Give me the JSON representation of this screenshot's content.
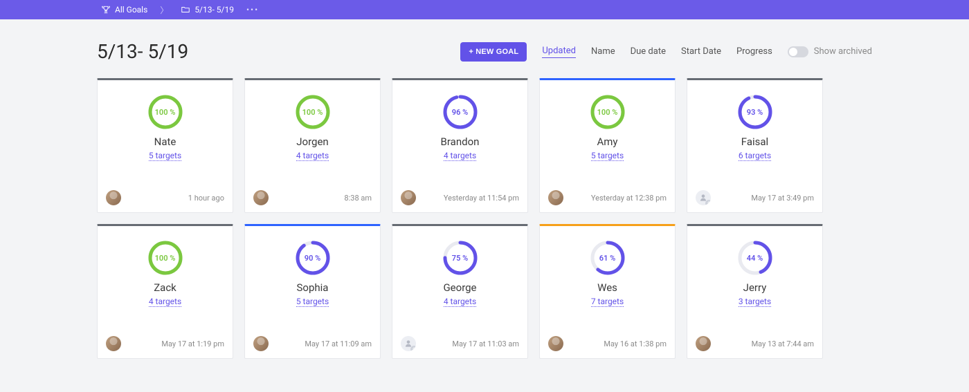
{
  "breadcrumb": {
    "root_label": "All Goals",
    "folder_label": "5/13- 5/19"
  },
  "page_title": "5/13- 5/19",
  "controls": {
    "add_button": "+ NEW GOAL",
    "filters": {
      "updated": "Updated",
      "name": "Name",
      "due_date": "Due date",
      "start_date": "Start Date",
      "progress": "Progress"
    },
    "show_archived_label": "Show archived"
  },
  "cards": [
    {
      "name": "Nate",
      "percent": 100,
      "color": "green",
      "bar": "grey",
      "targets_label": "5 targets",
      "timestamp": "1 hour ago",
      "avatar": "photo"
    },
    {
      "name": "Jorgen",
      "percent": 100,
      "color": "green",
      "bar": "grey",
      "targets_label": "4 targets",
      "timestamp": "8:38 am",
      "avatar": "photo"
    },
    {
      "name": "Brandon",
      "percent": 96,
      "color": "purple",
      "bar": "grey",
      "targets_label": "4 targets",
      "timestamp": "Yesterday at 11:54 pm",
      "avatar": "photo"
    },
    {
      "name": "Amy",
      "percent": 100,
      "color": "green",
      "bar": "blue",
      "targets_label": "5 targets",
      "timestamp": "Yesterday at 12:38 pm",
      "avatar": "photo"
    },
    {
      "name": "Faisal",
      "percent": 93,
      "color": "purple",
      "bar": "grey",
      "targets_label": "6 targets",
      "timestamp": "May 17 at 3:49 pm",
      "avatar": "add"
    },
    {
      "name": "Zack",
      "percent": 100,
      "color": "green",
      "bar": "grey",
      "targets_label": "4 targets",
      "timestamp": "May 17 at 1:19 pm",
      "avatar": "photo"
    },
    {
      "name": "Sophia",
      "percent": 90,
      "color": "purple",
      "bar": "blue",
      "targets_label": "5 targets",
      "timestamp": "May 17 at 11:09 am",
      "avatar": "photo"
    },
    {
      "name": "George",
      "percent": 75,
      "color": "purple",
      "bar": "grey",
      "targets_label": "4 targets",
      "timestamp": "May 17 at 11:03 am",
      "avatar": "add"
    },
    {
      "name": "Wes",
      "percent": 61,
      "color": "purple",
      "bar": "orange",
      "targets_label": "7 targets",
      "timestamp": "May 16 at 1:38 pm",
      "avatar": "photo"
    },
    {
      "name": "Jerry",
      "percent": 44,
      "color": "purple",
      "bar": "grey",
      "targets_label": "3 targets",
      "timestamp": "May 13 at 7:44 am",
      "avatar": "photo"
    }
  ]
}
